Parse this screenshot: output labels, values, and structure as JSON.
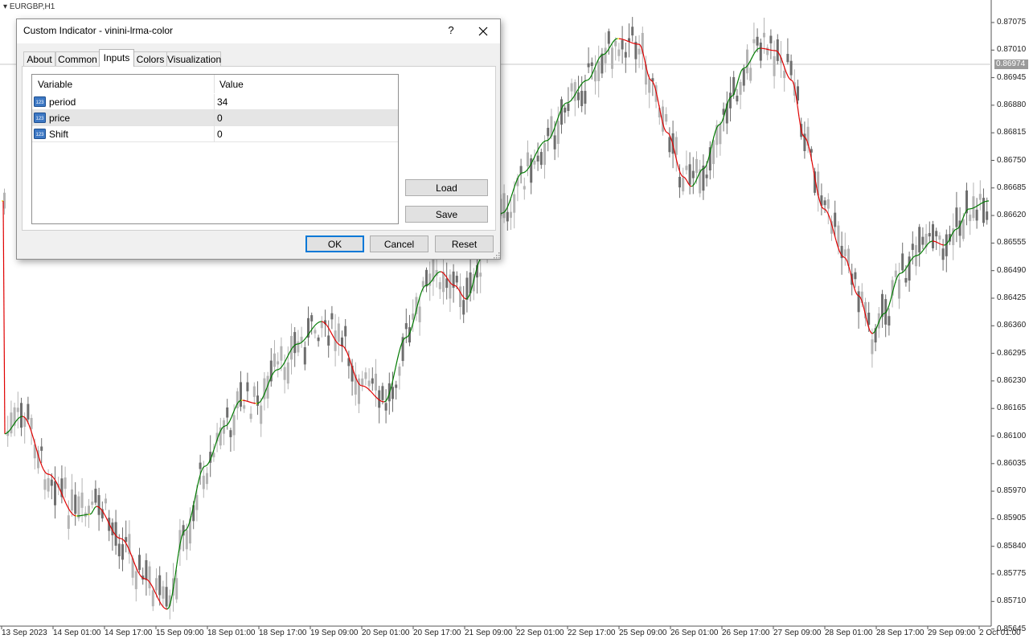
{
  "chart": {
    "symbol": "EURGBP,H1",
    "current_price": "0.86974",
    "price_labels": [
      "0.87075",
      "0.87010",
      "0.86945",
      "0.86880",
      "0.86815",
      "0.86750",
      "0.86685",
      "0.86620",
      "0.86555",
      "0.86490",
      "0.86425",
      "0.86360",
      "0.86295",
      "0.86230",
      "0.86165",
      "0.86100",
      "0.86035",
      "0.85970",
      "0.85905",
      "0.85840",
      "0.85775",
      "0.85710",
      "0.85645"
    ],
    "time_labels": [
      "13 Sep 2023",
      "14 Sep 01:00",
      "14 Sep 17:00",
      "15 Sep 09:00",
      "18 Sep 01:00",
      "18 Sep 17:00",
      "19 Sep 09:00",
      "20 Sep 01:00",
      "20 Sep 17:00",
      "21 Sep 09:00",
      "22 Sep 01:00",
      "22 Sep 17:00",
      "25 Sep 09:00",
      "26 Sep 01:00",
      "26 Sep 17:00",
      "27 Sep 09:00",
      "28 Sep 01:00",
      "28 Sep 17:00",
      "29 Sep 09:00",
      "2 Oct 01:00"
    ],
    "colors": {
      "up_line": "#007a00",
      "down_line": "#e00000",
      "flat_line": "#f0e000",
      "candle_dark": "#6e6e6e",
      "candle_light": "#b4b4b4"
    }
  },
  "dialog": {
    "title": "Custom Indicator - vinini-lrma-color",
    "help_label": "?",
    "close_icon": "close-icon",
    "tabs": [
      "About",
      "Common",
      "Inputs",
      "Colors",
      "Visualization"
    ],
    "active_tab": "Inputs",
    "grid": {
      "headers": {
        "variable": "Variable",
        "value": "Value"
      },
      "rows": [
        {
          "variable": "period",
          "value": "34"
        },
        {
          "variable": "price",
          "value": "0"
        },
        {
          "variable": "Shift",
          "value": "0"
        }
      ],
      "row_icon": "123-integer-icon"
    },
    "buttons": {
      "load": "Load",
      "save": "Save",
      "ok": "OK",
      "cancel": "Cancel",
      "reset": "Reset"
    }
  }
}
